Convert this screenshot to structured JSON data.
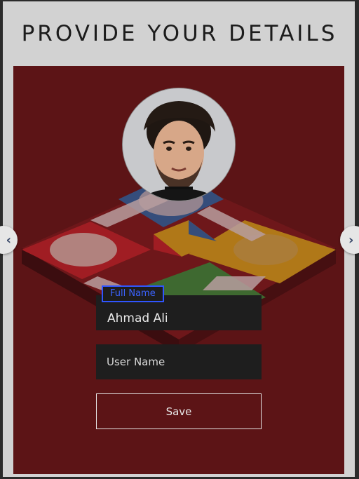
{
  "page": {
    "title": "PROVIDE YOUR DETAILS"
  },
  "nav": {
    "prev_icon": "chevron-left-icon",
    "next_icon": "chevron-right-icon",
    "prev_glyph": "‹",
    "next_glyph": "›"
  },
  "form": {
    "full_name": {
      "label": "Full Name",
      "value": "Ahmad Ali"
    },
    "user_name": {
      "placeholder": "User Name",
      "value": ""
    },
    "save_label": "Save"
  },
  "colors": {
    "panel_bg": "#5c1416",
    "label_accent": "#2f55ff",
    "field_bg": "#1e1e1e",
    "ludo_blue": "#1f6fb5",
    "ludo_red": "#c8242a",
    "ludo_yellow": "#e1b21a",
    "ludo_green": "#2e9a3e"
  }
}
